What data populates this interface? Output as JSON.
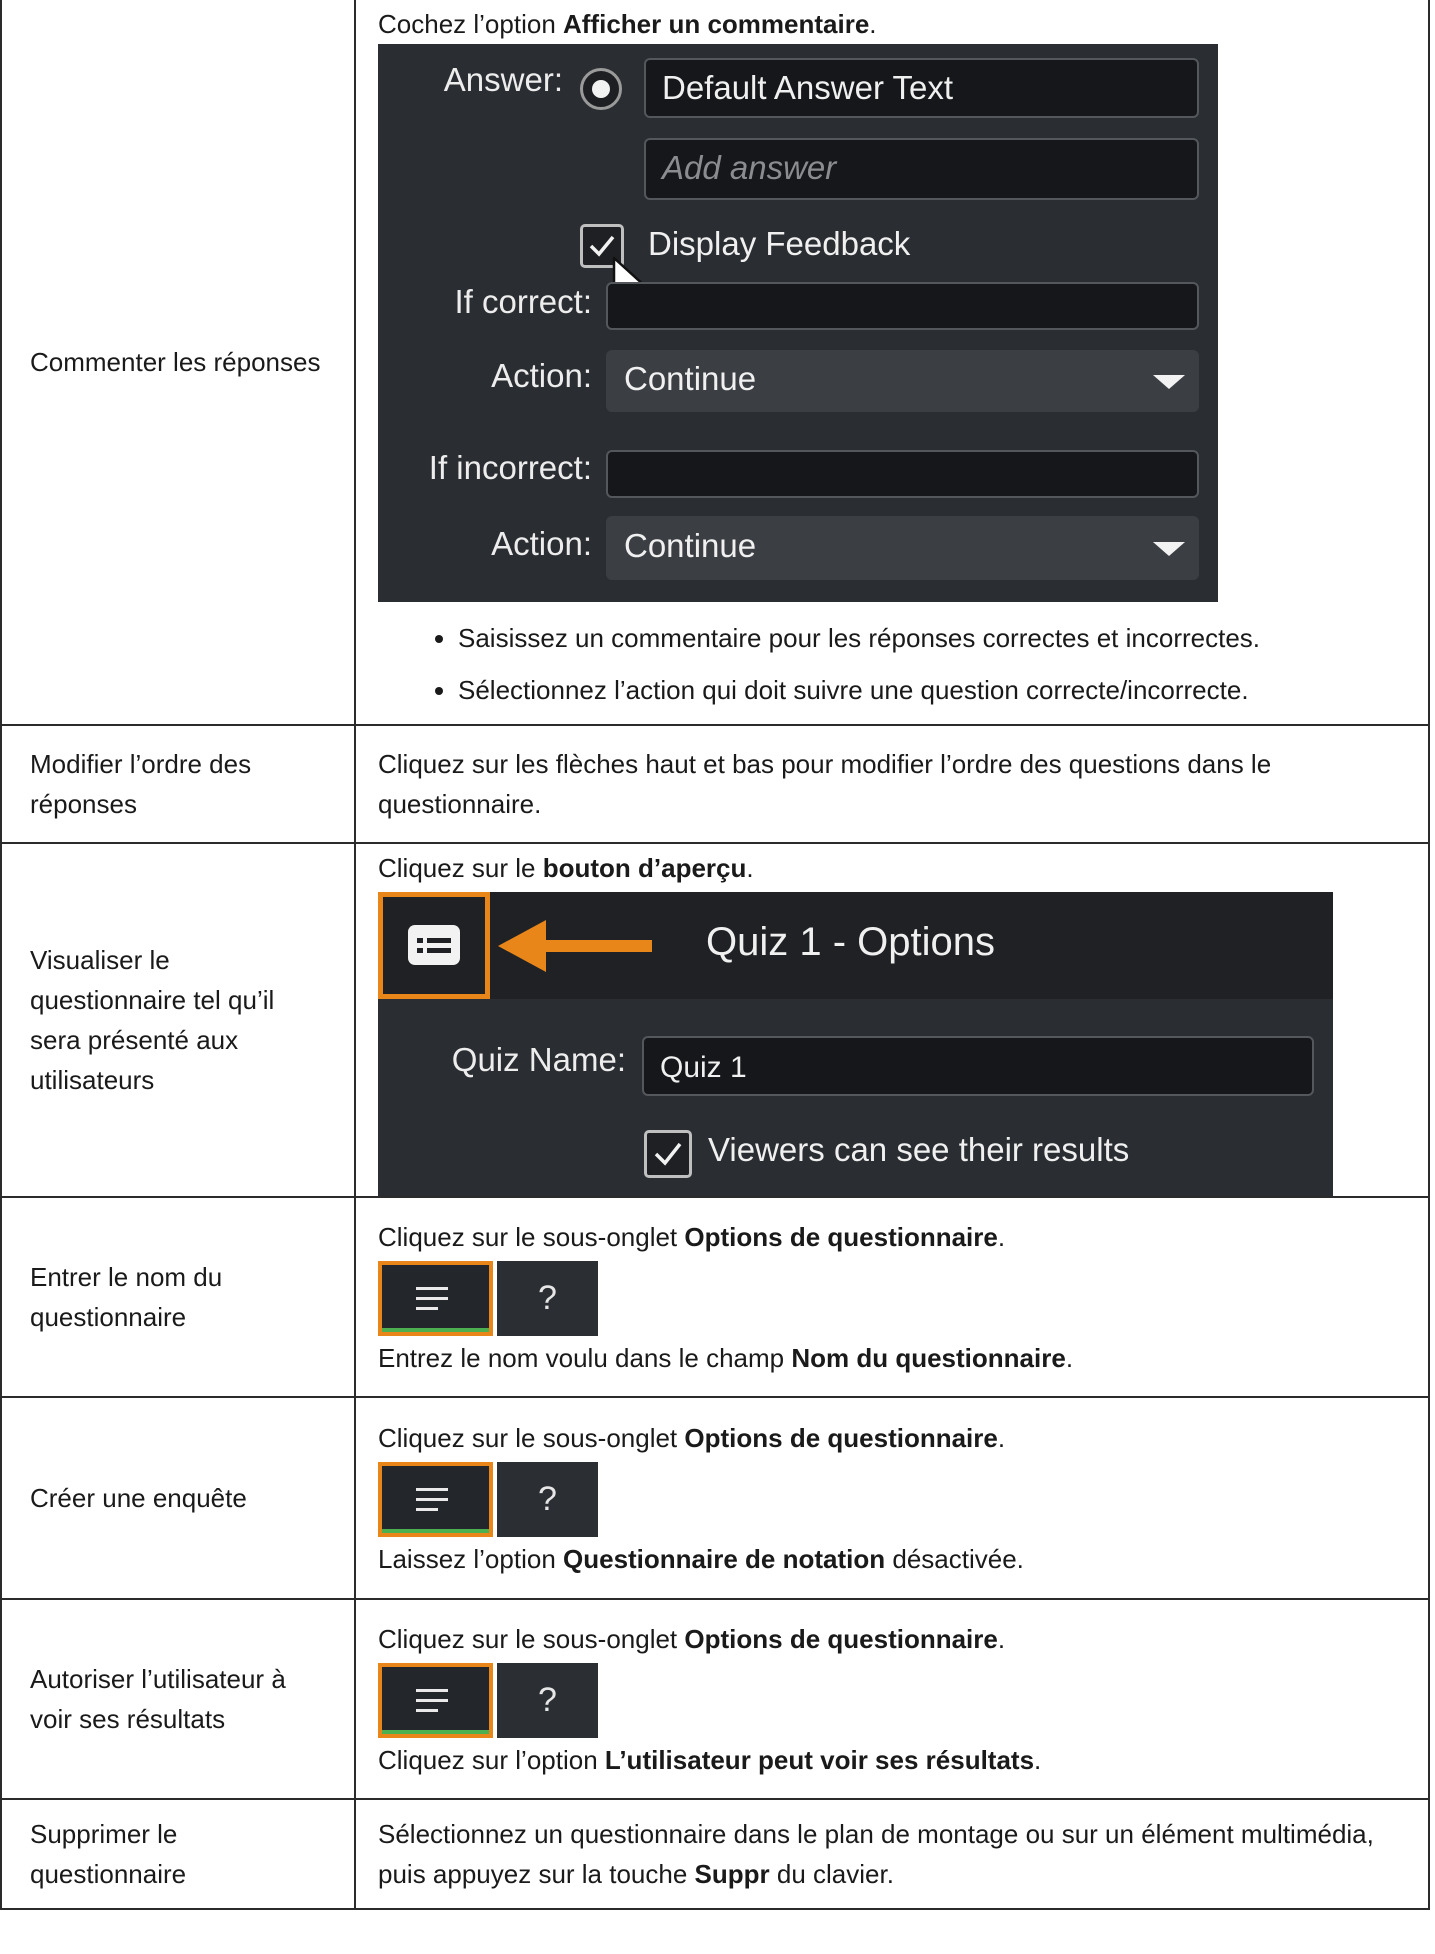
{
  "rows": [
    {
      "label": "Commenter les réponses",
      "intro": {
        "before": "Cochez l’option ",
        "bold": "Afficher un commentaire",
        "after": "."
      },
      "screenshot": {
        "answer_label": "Answer:",
        "answer_value": "Default Answer Text",
        "add_answer_placeholder": "Add answer",
        "display_feedback": "Display Feedback",
        "if_correct": "If correct:",
        "action_label": "Action:",
        "action_value": "Continue",
        "if_incorrect": "If incorrect:"
      },
      "bullets": [
        "Saisissez un commentaire pour les réponses correctes et incorrectes.",
        "Sélectionnez l’action qui doit suivre une question correcte/incorrecte."
      ]
    },
    {
      "label": "Modifier l’ordre des réponses",
      "text": "Cliquez sur les flèches haut et bas pour modifier l’ordre des questions dans le questionnaire."
    },
    {
      "label": "Visualiser le questionnaire tel qu’il sera présenté aux utilisateurs",
      "intro": {
        "before": "Cliquez sur le ",
        "bold": "bouton d’aperçu",
        "after": "."
      },
      "screenshot": {
        "title": "Quiz 1 - Options",
        "quiz_name_label": "Quiz Name:",
        "quiz_name_value": "Quiz 1",
        "viewers_label": "Viewers can see their results"
      }
    },
    {
      "label": "Entrer le nom du questionnaire",
      "intro": {
        "before": "Cliquez sur le sous-onglet ",
        "bold": "Options de questionnaire",
        "after": "."
      },
      "outro": {
        "before": "Entrez le nom voulu dans le champ ",
        "bold": "Nom du questionnaire",
        "after": "."
      }
    },
    {
      "label": "Créer une enquête",
      "intro": {
        "before": "Cliquez sur le sous-onglet ",
        "bold": "Options de questionnaire",
        "after": "."
      },
      "outro": {
        "before": "Laissez l’option ",
        "bold": "Questionnaire de notation",
        "after": " désactivée."
      }
    },
    {
      "label": "Autoriser l’utilisateur à voir ses résultats",
      "intro": {
        "before": "Cliquez sur le sous-onglet ",
        "bold": "Options de questionnaire",
        "after": "."
      },
      "outro": {
        "before": "Cliquez sur l’option ",
        "bold": "L’utilisateur peut voir ses résultats",
        "after": "."
      }
    },
    {
      "label": "Supprimer le questionnaire",
      "text": {
        "before": "Sélectionnez un questionnaire dans le plan de montage ou sur un élément multimédia, puis appuyez sur la touche ",
        "bold": "Suppr",
        "after": " du clavier."
      }
    }
  ],
  "tab_help_glyph": "?",
  "colors": {
    "highlight": "#e8861a",
    "panel_dark": "#2a2d31",
    "field_dark": "#15171a"
  },
  "icons": [
    "list-options-icon",
    "help-icon",
    "preview-icon",
    "checkbox-checked-icon",
    "radio-selected-icon",
    "dropdown-caret-icon",
    "mouse-cursor-icon",
    "orange-arrow-icon"
  ]
}
